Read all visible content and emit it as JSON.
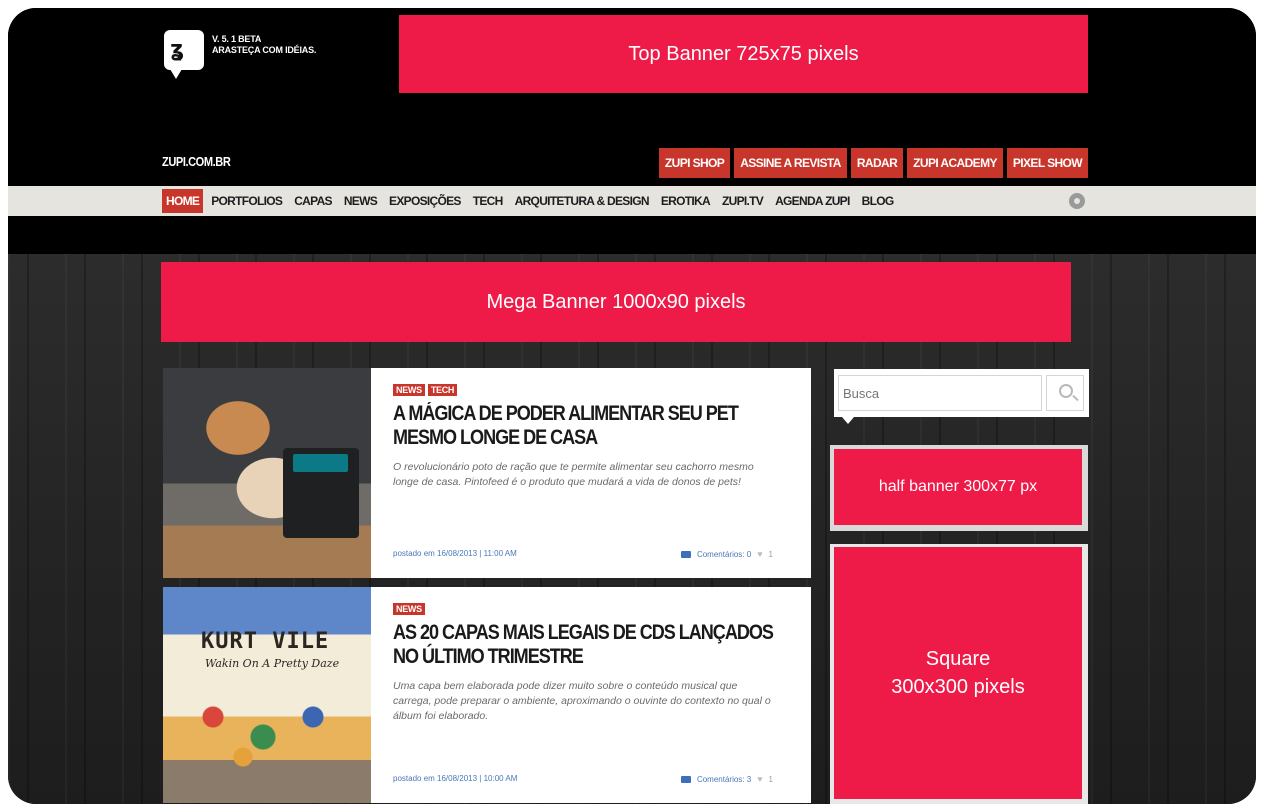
{
  "header": {
    "logo_text_line1": "V. 5. 1 BETA",
    "logo_text_line2": "ARASTEÇA COM IDÉIAS.",
    "site_name": "ZUPI.COM.BR",
    "top_links": [
      "ZUPI SHOP",
      "ASSINE A REVISTA",
      "RADAR",
      "ZUPI ACADEMY",
      "PIXEL SHOW"
    ]
  },
  "banners": {
    "top": "Top Banner 725x75 pixels",
    "mega": "Mega Banner 1000x90 pixels",
    "half": "half banner 300x77 px",
    "square_line1": "Square",
    "square_line2": "300x300 pixels"
  },
  "nav": {
    "items": [
      "HOME",
      "PORTFOLIOS",
      "CAPAS",
      "NEWS",
      "EXPOSIÇÕES",
      "TECH",
      "ARQUITETURA & DESIGN",
      "EROTIKA",
      "ZUPI.TV",
      "AGENDA ZUPI",
      "BLOG"
    ],
    "active": "HOME"
  },
  "search": {
    "placeholder": "Busca"
  },
  "articles": [
    {
      "tags": [
        "NEWS",
        "TECH"
      ],
      "title": "A MÁGICA DE PODER ALIMENTAR SEU PET MESMO LONGE DE CASA",
      "excerpt": "O revolucionário poto de ração que te permite alimentar seu cachorro mesmo longe de casa. Pintofeed é o produto que mudará a vida de donos de pets!",
      "posted": "postado em 16/08/2013 | 11:00 AM",
      "comments": "Comentários: 0",
      "likes": "1"
    },
    {
      "tags": [
        "NEWS"
      ],
      "title": "AS 20 CAPAS MAIS LEGAIS DE CDS LANÇADOS NO ÚLTIMO TRIMESTRE",
      "excerpt": "Uma capa bem elaborada pode dizer muito sobre o conteúdo musical que carrega, pode preparar o ambiente, aproximando o ouvinte do contexto no qual o álbum foi elaborado.",
      "posted": "postado em 16/08/2013 | 10:00 AM",
      "comments": "Comentários: 3",
      "likes": "1",
      "thumb_title": "KURT VILE",
      "thumb_sub": "Wakin On A Pretty Daze"
    }
  ],
  "colors": {
    "banner_red": "#ee1b48",
    "nav_red": "#c8352b",
    "nav_bg": "#e6e4df",
    "link_blue": "#4a78b8"
  }
}
